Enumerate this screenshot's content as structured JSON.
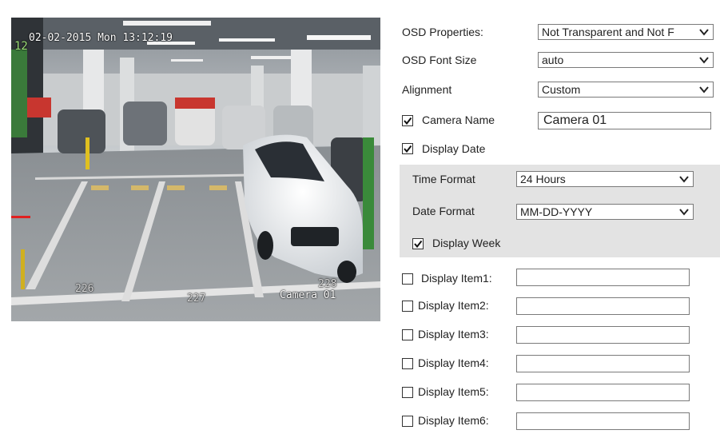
{
  "preview": {
    "timestamp": "02-02-2015 Mon 13:12:19",
    "camera_name_overlay": "Camera 01",
    "parking_numbers": [
      "226",
      "227",
      "228"
    ],
    "side_number": "12"
  },
  "osd_properties": {
    "label": "OSD Properties:",
    "value": "Not Transparent and Not F"
  },
  "osd_font_size": {
    "label": "OSD Font Size",
    "value": "auto"
  },
  "alignment": {
    "label": "Alignment",
    "value": "Custom"
  },
  "camera_name": {
    "label": "Camera Name",
    "checked": true,
    "value": "Camera 01"
  },
  "display_date": {
    "label": "Display Date",
    "checked": true
  },
  "time_format": {
    "label": "Time Format",
    "value": "24 Hours"
  },
  "date_format": {
    "label": "Date Format",
    "value": "MM-DD-YYYY"
  },
  "display_week": {
    "label": "Display Week",
    "checked": true
  },
  "display_items": [
    {
      "label": "Display Item1:",
      "checked": false,
      "value": ""
    },
    {
      "label": "Display Item2:",
      "checked": false,
      "value": ""
    },
    {
      "label": "Display Item3:",
      "checked": false,
      "value": ""
    },
    {
      "label": "Display Item4:",
      "checked": false,
      "value": ""
    },
    {
      "label": "Display Item5:",
      "checked": false,
      "value": ""
    },
    {
      "label": "Display Item6:",
      "checked": false,
      "value": ""
    }
  ],
  "colors": {
    "panel_bg": "#e3e3e3",
    "border": "#7a7a7a"
  }
}
